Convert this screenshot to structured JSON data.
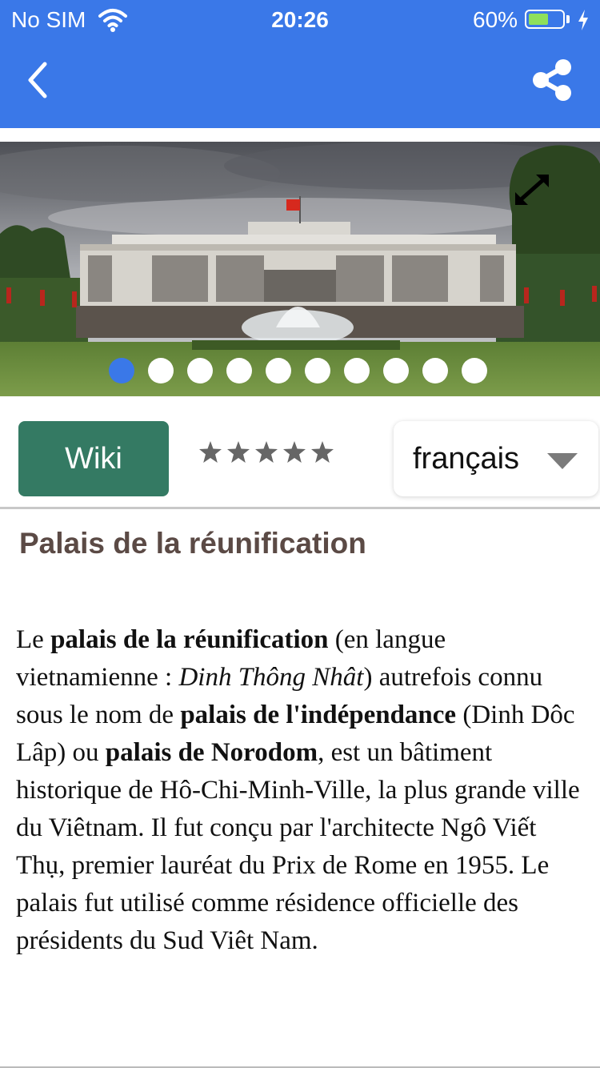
{
  "status_bar": {
    "carrier": "No SIM",
    "time": "20:26",
    "battery_percent": "60%",
    "battery_level": 0.6
  },
  "header": {
    "back_icon": "chevron-left-icon",
    "share_icon": "share-icon",
    "color": "#3a78e8"
  },
  "gallery": {
    "image": "photo of the Palais de la réunification with fountain and lawn",
    "expand_icon": "expand-icon",
    "dot_count": 10,
    "active_index": 0
  },
  "toolbar": {
    "wiki_label": "Wiki",
    "rating": {
      "max": 5,
      "value": 0
    },
    "language": "français"
  },
  "article": {
    "title": "Palais de la réunification",
    "paragraph": [
      {
        "t": "Le ",
        "s": "n"
      },
      {
        "t": "palais de la réunification",
        "s": "b"
      },
      {
        "t": " (en langue vietnamienne : ",
        "s": "n"
      },
      {
        "t": "Dinh Thông Nhât",
        "s": "i"
      },
      {
        "t": ") autrefois connu sous le nom de ",
        "s": "n"
      },
      {
        "t": "palais de l'indépendance",
        "s": "b"
      },
      {
        "t": " (Dinh Dôc Lâp) ou ",
        "s": "n"
      },
      {
        "t": "palais de Norodom",
        "s": "b"
      },
      {
        "t": ", est un bâtiment historique de Hô-Chi-Minh-Ville, la plus grande ville du Viêtnam. Il fut conçu par l'architecte Ngô Viết Thụ, premier lauréat du Prix de Rome en 1955. Le palais fut utilisé comme résidence officielle des présidents du Sud Viêt Nam.",
        "s": "n"
      }
    ]
  }
}
